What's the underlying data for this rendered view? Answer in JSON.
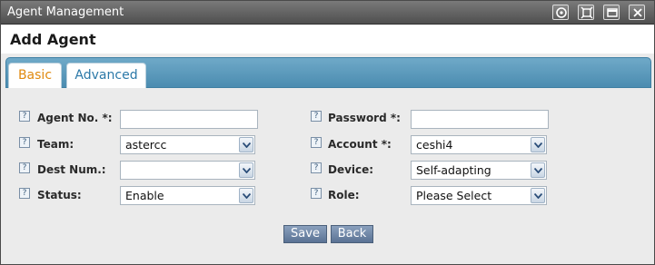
{
  "window": {
    "title": "Agent Management"
  },
  "page": {
    "heading": "Add Agent"
  },
  "tabs": [
    {
      "label": "Basic",
      "active": true
    },
    {
      "label": "Advanced",
      "active": false
    }
  ],
  "form": {
    "help_glyph": "?",
    "agent_no": {
      "label": "Agent No. *:",
      "value": ""
    },
    "team": {
      "label": "Team:",
      "value": "astercc"
    },
    "dest_num": {
      "label": "Dest Num.:",
      "value": ""
    },
    "status": {
      "label": "Status:",
      "value": "Enable"
    },
    "password": {
      "label": "Password *:",
      "value": ""
    },
    "account": {
      "label": "Account *:",
      "value": "ceshi4"
    },
    "device": {
      "label": "Device:",
      "value": "Self-adapting"
    },
    "role": {
      "label": "Role:",
      "value": "Please Select"
    }
  },
  "buttons": {
    "save": "Save",
    "back": "Back"
  },
  "colors": {
    "tab_bar": "#5b9abd",
    "active_tab_text": "#e08a0f",
    "inactive_tab_text": "#2c79a8",
    "button": "#6f86a6"
  },
  "icons": [
    "restore-icon",
    "fit-icon",
    "minimize-icon",
    "close-icon",
    "help-icon",
    "dropdown-arrow-icon"
  ]
}
